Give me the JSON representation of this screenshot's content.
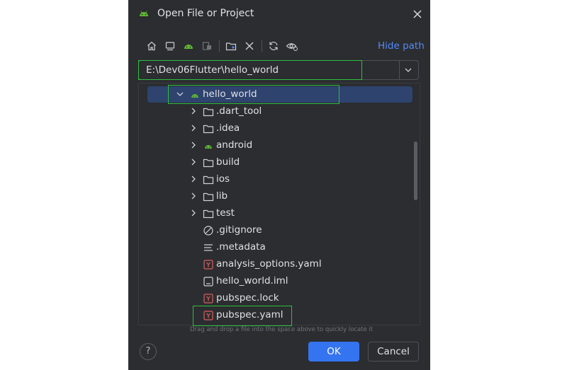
{
  "dialog": {
    "title": "Open File or Project",
    "toolbar": {
      "buttons": [
        "home-icon",
        "desktop-icon",
        "android-project-icon",
        "module-icon",
        "new-folder-icon",
        "delete-icon",
        "refresh-icon",
        "show-hidden-icon"
      ],
      "hide_path_label": "Hide path"
    },
    "path": {
      "value": "E:\\Dev06Flutter\\hello_world"
    },
    "tree": {
      "rows": [
        {
          "label": "hello_world",
          "icon": "android-icon",
          "expanded": true,
          "selected": true
        },
        {
          "label": ".dart_tool",
          "icon": "folder-icon",
          "expandable": true
        },
        {
          "label": ".idea",
          "icon": "folder-icon",
          "expandable": true
        },
        {
          "label": "android",
          "icon": "android-icon",
          "expandable": true
        },
        {
          "label": "build",
          "icon": "folder-icon",
          "expandable": true
        },
        {
          "label": "ios",
          "icon": "folder-icon",
          "expandable": true
        },
        {
          "label": "lib",
          "icon": "folder-icon",
          "expandable": true
        },
        {
          "label": "test",
          "icon": "folder-icon",
          "expandable": true
        },
        {
          "label": ".gitignore",
          "icon": "ignore-file-icon"
        },
        {
          "label": ".metadata",
          "icon": "text-file-icon"
        },
        {
          "label": "analysis_options.yaml",
          "icon": "yaml-file-icon"
        },
        {
          "label": "hello_world.iml",
          "icon": "iml-file-icon"
        },
        {
          "label": "pubspec.lock",
          "icon": "yaml-file-icon"
        },
        {
          "label": "pubspec.yaml",
          "icon": "yaml-file-icon"
        }
      ]
    },
    "drag_hint": "Drag and drop a file into the space above to quickly locate it",
    "buttons": {
      "help": "?",
      "ok": "OK",
      "cancel": "Cancel"
    }
  },
  "colors": {
    "dialog_bg": "#2b2d30",
    "accent": "#3574f0",
    "link": "#548af7",
    "selection": "#2e436e",
    "highlight_box": "#2fbf3f",
    "android_green": "#5fb832",
    "yaml_red": "#d95f5f"
  }
}
